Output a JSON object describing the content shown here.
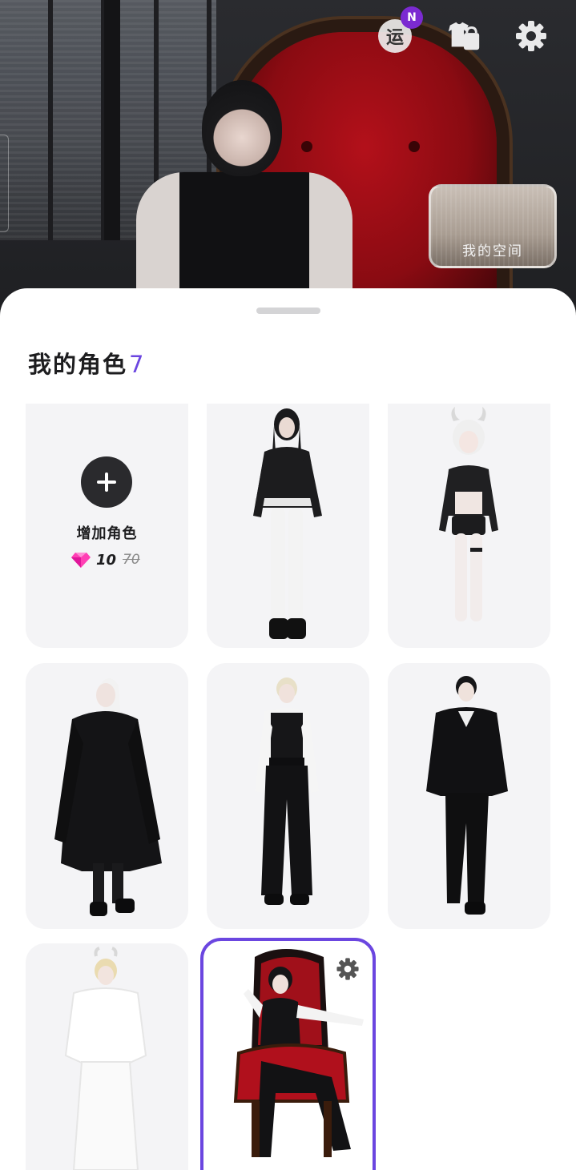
{
  "header": {
    "luck_label": "运",
    "badge": "N",
    "space_label": "我的空间"
  },
  "sheet": {
    "title": "我的角色",
    "count": "7"
  },
  "add_card": {
    "label": "增加角色",
    "price": "10",
    "original_price": "70"
  },
  "colors": {
    "accent": "#6b46e0",
    "badge": "#7b2ad1",
    "gem": "#ff3fb4"
  },
  "characters": [
    {
      "name": "character-long-black-hair-sweater"
    },
    {
      "name": "character-horned-white-hair"
    },
    {
      "name": "character-white-hair-fur-coat"
    },
    {
      "name": "character-blond-vest-wide-pants"
    },
    {
      "name": "character-black-hair-hoodie"
    },
    {
      "name": "character-all-white-outfit"
    },
    {
      "name": "character-on-red-throne",
      "selected": true
    }
  ]
}
